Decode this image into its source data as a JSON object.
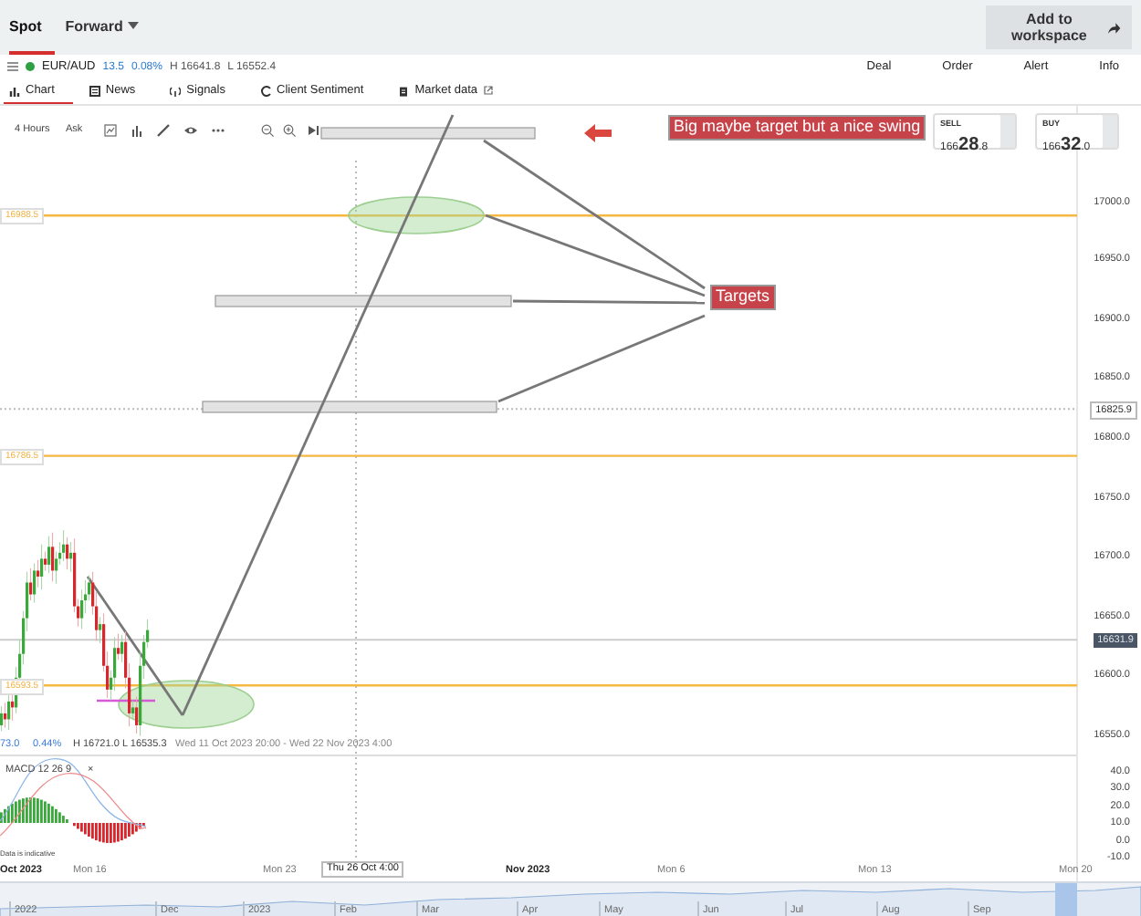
{
  "top_tabs": [
    {
      "label": "Spot",
      "selected": true,
      "kind": "plain"
    },
    {
      "label": "Forward",
      "selected": false,
      "kind": "dropdown"
    }
  ],
  "workspace_button": "Add to workspace",
  "instrument": {
    "symbol": "EUR/AUD",
    "change": "13.5",
    "change_pct": "0.08%",
    "high": "H 16641.8",
    "low": "L 16552.4"
  },
  "actions": [
    "Deal",
    "Order",
    "Alert",
    "Info"
  ],
  "tabs": [
    {
      "label": "Chart",
      "selected": true,
      "kind": "chart"
    },
    {
      "label": "News",
      "selected": false,
      "kind": "news"
    },
    {
      "label": "Signals",
      "selected": false,
      "kind": "signals"
    },
    {
      "label": "Client Sentiment",
      "selected": false,
      "kind": "sentiment"
    },
    {
      "label": "Market data",
      "selected": false,
      "kind": "market"
    }
  ],
  "toolbar": {
    "interval": "4 Hours",
    "price_type": "Ask"
  },
  "quotes": [
    {
      "label": "SELL",
      "prefix": "166",
      "big": "28",
      "suffix": ".8"
    },
    {
      "label": "BUY",
      "prefix": "166",
      "big": "32",
      "suffix": ".0"
    }
  ],
  "notes": [
    "Big maybe target but a nice swing",
    "Targets"
  ],
  "price_axis": [
    "17000.0",
    "16950.0",
    "16900.0",
    "16850.0",
    "16800.0",
    "16750.0",
    "16700.0",
    "16650.0",
    "16600.0",
    "16550.0"
  ],
  "price_tags": [
    {
      "kind": "marker",
      "text": "16825.9"
    },
    {
      "kind": "current",
      "text": "16631.9"
    }
  ],
  "level_tags": [
    "16988.5",
    "16786.5",
    "16593.5"
  ],
  "ohlc": {
    "open": "73.0",
    "pct": "0.44%",
    "high": "H 16721.0",
    "low": "L 16535.3",
    "range": "Wed 11 Oct 2023 20:00 - Wed 22 Nov 2023 4:00"
  },
  "macd": {
    "label": "MACD",
    "params": [
      "12",
      "26",
      "9"
    ],
    "close": "×",
    "axis": [
      "40.0",
      "30.0",
      "20.0",
      "10.0",
      "0.0",
      "-10.0"
    ],
    "note": "Data is indicative"
  },
  "time_axis": [
    {
      "kind": "major",
      "text": "Oct 2023"
    },
    {
      "kind": "minor",
      "text": "Mon 16"
    },
    {
      "kind": "minor",
      "text": "Mon 23"
    },
    {
      "kind": "crosshair",
      "text": "Thu 26 Oct 4:00"
    },
    {
      "kind": "major",
      "text": "Nov 2023"
    },
    {
      "kind": "minor",
      "text": "Mon 6"
    },
    {
      "kind": "minor",
      "text": "Mon 13"
    },
    {
      "kind": "minor",
      "text": "Mon 20"
    }
  ],
  "navigator": [
    "2022",
    "Dec",
    "2023",
    "Feb",
    "Mar",
    "Apr",
    "May",
    "Jun",
    "Jul",
    "Aug",
    "Sep"
  ]
}
